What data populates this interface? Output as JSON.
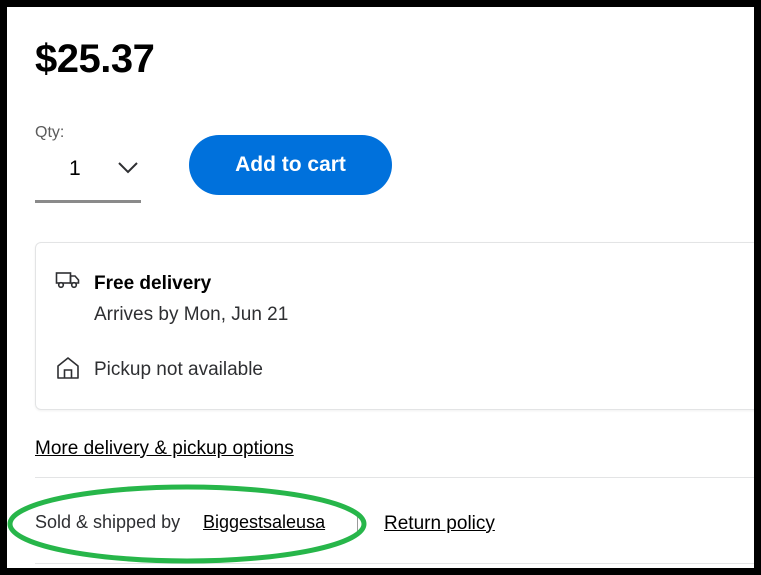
{
  "price": "$25.37",
  "quantity": {
    "label": "Qty:",
    "value": "1"
  },
  "cart": {
    "add_label": "Add to cart"
  },
  "delivery": {
    "title": "Free delivery",
    "arrival": "Arrives by Mon, Jun 21",
    "pickup": "Pickup not available"
  },
  "links": {
    "more_options": "More delivery & pickup options",
    "return_policy": "Return policy"
  },
  "seller": {
    "prefix": "Sold & shipped by",
    "name": "Biggestsaleusa"
  },
  "colors": {
    "primary_button": "#0071dc",
    "annotation_ellipse": "#27b64a",
    "frame_border": "#000000"
  },
  "icons": [
    "truck-icon",
    "store-icon",
    "chevron-down-icon"
  ]
}
